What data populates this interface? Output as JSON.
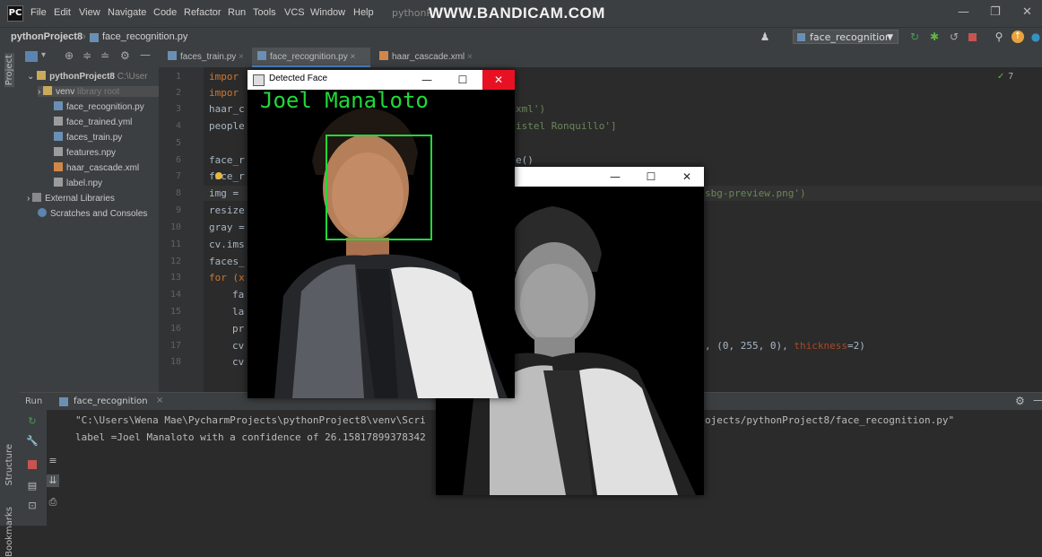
{
  "window": {
    "menus": [
      "File",
      "Edit",
      "View",
      "Navigate",
      "Code",
      "Refactor",
      "Run",
      "Tools",
      "VCS",
      "Window",
      "Help"
    ],
    "title_fragment": "pythonP",
    "watermark": "WWW.BANDICAM.COM"
  },
  "navbar": {
    "project": "pythonProject8",
    "file": "face_recognition.py",
    "run_config": "face_recognition"
  },
  "project_panel": {
    "header": "Project",
    "root": "pythonProject8",
    "root_path": "C:\\User",
    "venv": "venv",
    "venv_note": "library root",
    "files": [
      "face_recognition.py",
      "face_trained.yml",
      "faces_train.py",
      "features.npy",
      "haar_cascade.xml",
      "label.npy"
    ],
    "external": "External Libraries",
    "scratches": "Scratches and Consoles"
  },
  "tabs": [
    "faces_train.py",
    "face_recognition.py",
    "haar_cascade.xml"
  ],
  "editor": {
    "line_numbers": [
      "1",
      "2",
      "3",
      "4",
      "5",
      "6",
      "7",
      "8",
      "9",
      "10",
      "11",
      "12",
      "13",
      "14",
      "15",
      "16",
      "17",
      "18"
    ],
    "visible_code": {
      "l1": "impor",
      "l2": "impor",
      "l3": "haar_c",
      "l4": "people",
      "l6": "face_r",
      "l7": "face_r",
      "l8": "img = ",
      "l9": "resize",
      "l10": "gray =",
      "l11": "cv.ims",
      "l12": "faces_",
      "l13": "for (x",
      "l14": "fa",
      "l15": "la",
      "l16": "pr",
      "l17": "cv",
      "l18": "cv"
    },
    "right_fragments": {
      "r3": "xml')",
      "r4": "istel Ronquillo']",
      "r6": "e()",
      "r8": "sbg-preview.png')",
      "r17_a": ", (0, 255, 0), ",
      "r17_kw": "thickness",
      "r17_b": "=2)"
    },
    "inspection_count": "7"
  },
  "run_panel": {
    "tab_run": "Run",
    "tab_config": "face_recognition",
    "line1_left": "\"C:\\Users\\Wena Mae\\PycharmProjects\\pythonProject8\\venv\\Scri",
    "line1_right": "ojects/pythonProject8/face_recognition.py\"",
    "line2": "label =Joel Manaloto with a confidence of 26.15817899378342"
  },
  "side_labels": {
    "structure": "Structure",
    "bookmarks": "Bookmarks"
  },
  "cv_window_main": {
    "title": "Detected Face",
    "overlay_text": "Joel Manaloto",
    "box_color": "#22d83a",
    "text_color": "#22d83a"
  },
  "cv_window_second": {
    "title": ""
  },
  "colors": {
    "ide_bg": "#2b2b2b",
    "panel_bg": "#3c3f41",
    "close_red": "#e81123"
  }
}
